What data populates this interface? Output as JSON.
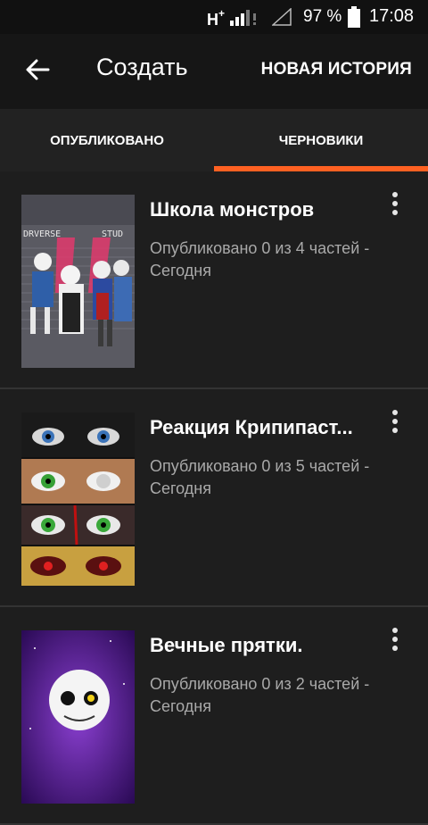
{
  "status_bar": {
    "network": "H",
    "network_suffix": "+",
    "battery": "97 %",
    "time": "17:08"
  },
  "app_bar": {
    "back_icon": "arrow-back-icon",
    "title": "Создать",
    "action": "НОВАЯ ИСТОРИЯ"
  },
  "tabs": [
    {
      "label": "ОПУБЛИКОВАНО",
      "active": false
    },
    {
      "label": "ЧЕРНОВИКИ",
      "active": true
    }
  ],
  "colors": {
    "accent": "#ff6122",
    "background": "#161616",
    "card": "#1e1e1e",
    "secondary_text": "#a9a9a9"
  },
  "stories": [
    {
      "title": "Школа монстров",
      "meta_line1": "Опубликовано 0 из 4 частей -",
      "meta_line2": "Сегодня",
      "cover_text_left": "DRVERSE",
      "cover_text_right": "STUD",
      "cover_icon": "monster-school-cover",
      "menu_icon": "more-vertical-icon"
    },
    {
      "title": "Реакция Крипипаст...",
      "meta_line1": "Опубликовано 0 из 5 частей -",
      "meta_line2": "Сегодня",
      "cover_icon": "eyes-collage-cover",
      "menu_icon": "more-vertical-icon"
    },
    {
      "title": "Вечные прятки.",
      "meta_line1": "Опубликовано 0 из 2 частей -",
      "meta_line2": "Сегодня",
      "cover_icon": "skull-space-cover",
      "menu_icon": "more-vertical-icon"
    }
  ]
}
